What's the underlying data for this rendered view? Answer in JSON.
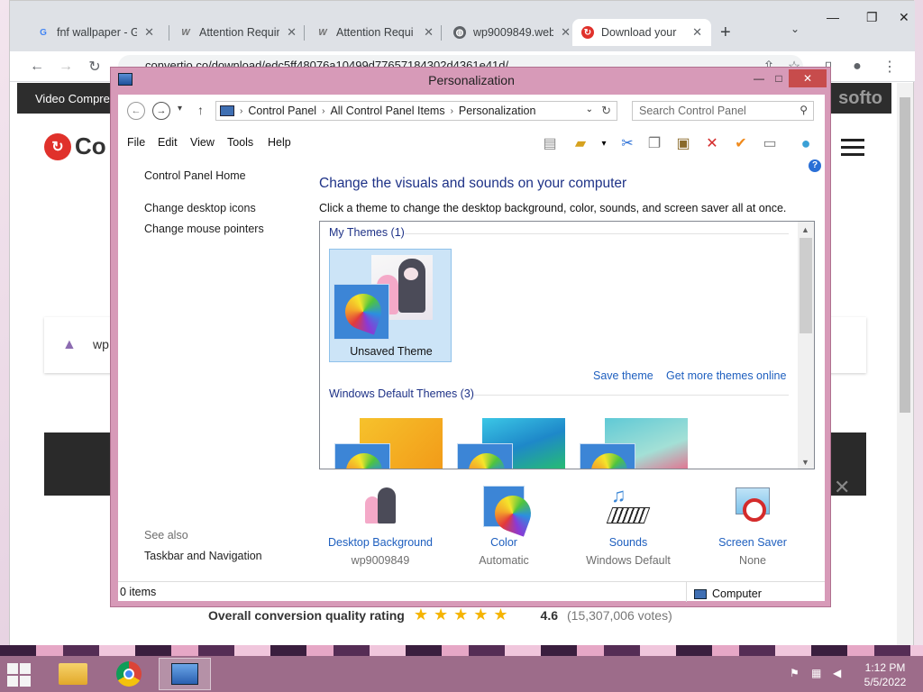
{
  "browser": {
    "tabs": [
      {
        "title": "fnf wallpaper - G",
        "favicon": "google-icon"
      },
      {
        "title": "Attention Requir",
        "favicon": "w-icon"
      },
      {
        "title": "Attention Requi",
        "favicon": "w-icon"
      },
      {
        "title": "wp9009849.web",
        "favicon": "globe-icon"
      },
      {
        "title": "Download your",
        "favicon": "convertio-icon"
      }
    ],
    "url": "convertio.co/download/edc5ff48076a10499d77657184302d4361e41d/"
  },
  "site": {
    "nav_item": "Video Compres",
    "brand_partial": "softo",
    "logo_partial": "Co",
    "file_name_partial": "wp",
    "rating_label": "Overall conversion quality rating",
    "rating_stars": "★★★★★",
    "rating_score": "4.6",
    "rating_votes": "(15,307,006 votes)"
  },
  "window": {
    "title": "Personalization",
    "breadcrumb": [
      "Control Panel",
      "All Control Panel Items",
      "Personalization"
    ],
    "search_placeholder": "Search Control Panel",
    "menu": [
      "File",
      "Edit",
      "View",
      "Tools",
      "Help"
    ]
  },
  "left_pane": {
    "home": "Control Panel Home",
    "links": [
      "Change desktop icons",
      "Change mouse pointers"
    ],
    "see_also_label": "See also",
    "see_also_links": [
      "Taskbar and Navigation"
    ]
  },
  "main": {
    "heading": "Change the visuals and sounds on your computer",
    "subheading": "Click a theme to change the desktop background, color, sounds, and screen saver all at once.",
    "my_themes_label": "My Themes (1)",
    "unsaved_theme": "Unsaved Theme",
    "save_theme": "Save theme",
    "get_more": "Get more themes online",
    "default_themes_label": "Windows Default Themes (3)"
  },
  "bottom": [
    {
      "label": "Desktop Background",
      "value": "wp9009849"
    },
    {
      "label": "Color",
      "value": "Automatic"
    },
    {
      "label": "Sounds",
      "value": "Windows Default"
    },
    {
      "label": "Screen Saver",
      "value": "None"
    }
  ],
  "status": {
    "items": "0 items",
    "location": "Computer"
  },
  "taskbar": {
    "time": "1:12 PM",
    "date": "5/5/2022"
  },
  "colors": {
    "window_frame": "#d79ab8",
    "close_button": "#c74c4c",
    "link_blue": "#1e5fbf",
    "heading_blue": "#1e3287",
    "taskbar": "#9d6c8a"
  }
}
